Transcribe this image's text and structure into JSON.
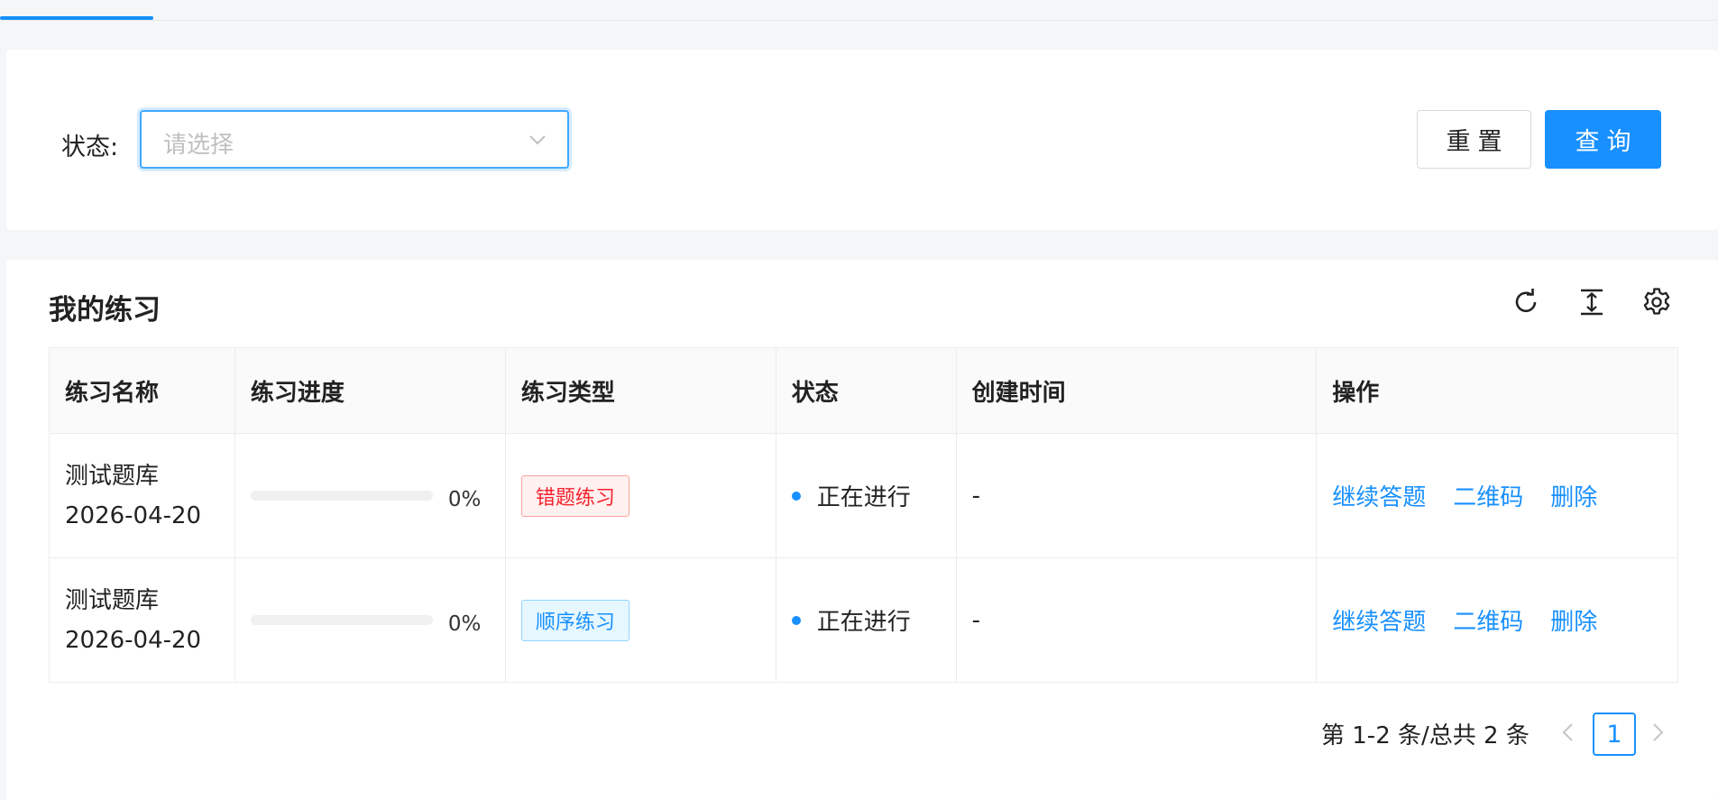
{
  "filter": {
    "status_label": "状态:",
    "status_placeholder": "请选择",
    "reset_label": "重置",
    "query_label": "查询"
  },
  "list": {
    "title": "我的练习",
    "columns": [
      "练习名称",
      "练习进度",
      "练习类型",
      "状态",
      "创建时间",
      "操作"
    ],
    "rows": [
      {
        "name_line1": "测试题库",
        "name_line2": "2026-04-20",
        "progress_percent": 0,
        "progress_text": "0%",
        "type": "错题练习",
        "type_color": "#f5222d",
        "status": "正在进行",
        "created": "-",
        "actions": [
          "继续答题",
          "二维码",
          "删除"
        ]
      },
      {
        "name_line1": "测试题库",
        "name_line2": "2026-04-20",
        "progress_percent": 0,
        "progress_text": "0%",
        "type": "顺序练习",
        "type_color": "#1890ff",
        "status": "正在进行",
        "created": "-",
        "actions": [
          "继续答题",
          "二维码",
          "删除"
        ]
      }
    ]
  },
  "pagination": {
    "summary": "第 1-2 条/总共 2 条",
    "current_page": "1"
  },
  "icons": {
    "refresh": "reload-icon",
    "density": "column-height-icon",
    "settings": "gear-icon"
  },
  "colors": {
    "primary": "#1890ff",
    "danger": "#f5222d"
  }
}
